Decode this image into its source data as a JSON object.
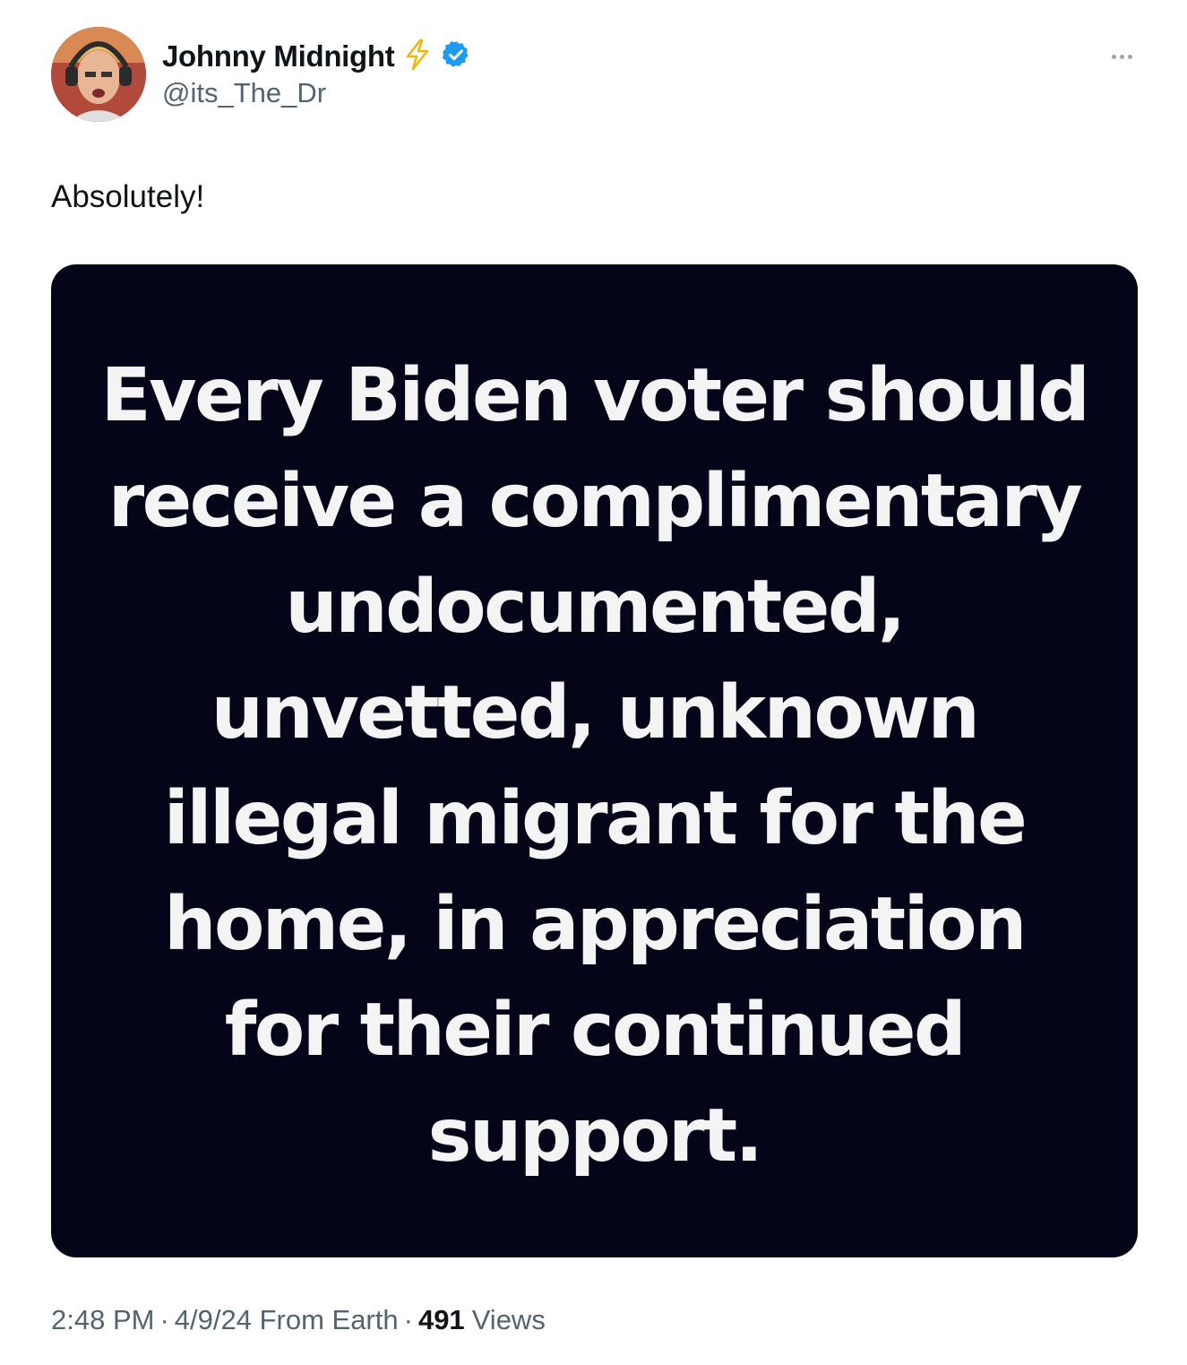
{
  "author": {
    "display_name": "Johnny Midnight",
    "handle": "@its_The_Dr",
    "badges": [
      "lightning-icon",
      "verified-badge-icon"
    ],
    "verified_color": "#1d9bf0",
    "lightning_color": "#f4b400"
  },
  "more_menu_icon": "more-options-icon",
  "tweet": {
    "text": "Absolutely!"
  },
  "media": {
    "background": "#05051a",
    "lines": [
      "Every Biden voter should",
      "receive a complimentary",
      "undocumented,",
      "unvetted, unknown",
      "illegal migrant for the",
      "home, in appreciation",
      "for their continued",
      "support."
    ]
  },
  "meta": {
    "time": "2:48 PM",
    "date_source": "4/9/24 From Earth",
    "views_count": "491",
    "views_label": "Views",
    "separator": "·"
  }
}
